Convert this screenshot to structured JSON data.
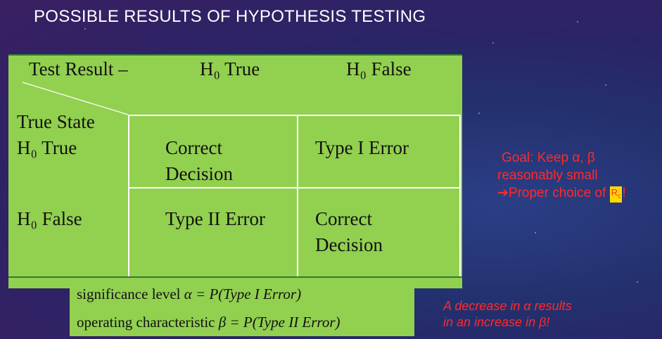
{
  "title": "POSSIBLE RESULTS OF HYPOTHESIS TESTING",
  "table": {
    "header_test_result": "Test Result –",
    "header_h0_true": "H₀ True",
    "header_h0_false": "H₀ False",
    "row_label_true_state": "True State",
    "row_label_h0_true": "H₀ True",
    "row_label_h0_false": "H₀ False",
    "cell_true_true_line1": "Correct",
    "cell_true_true_line2": "Decision",
    "cell_true_false": "Type I Error",
    "cell_false_true": "Type II Error",
    "cell_false_false_line1": "Correct",
    "cell_false_false_line2": "Decision"
  },
  "formulas": {
    "significance_label": "significance level",
    "significance_expr": "α = P(Type I  Error)",
    "operating_label": "operating characteristic",
    "operating_expr": "β = P(Type II  Error)"
  },
  "goal": {
    "line1": "Goal: Keep α, β",
    "line2": "reasonably small",
    "line3_arrow": "➔",
    "line3_text": "Proper choice of ",
    "badge": "R",
    "badge_sub": "c",
    "line3_end": "!"
  },
  "note": {
    "line1": "A decrease in α results",
    "line2": "in an increase in β!"
  },
  "colors": {
    "table_bg": "#92d050",
    "accent_red": "#ff2a2a",
    "badge_yellow": "#ffd800"
  }
}
